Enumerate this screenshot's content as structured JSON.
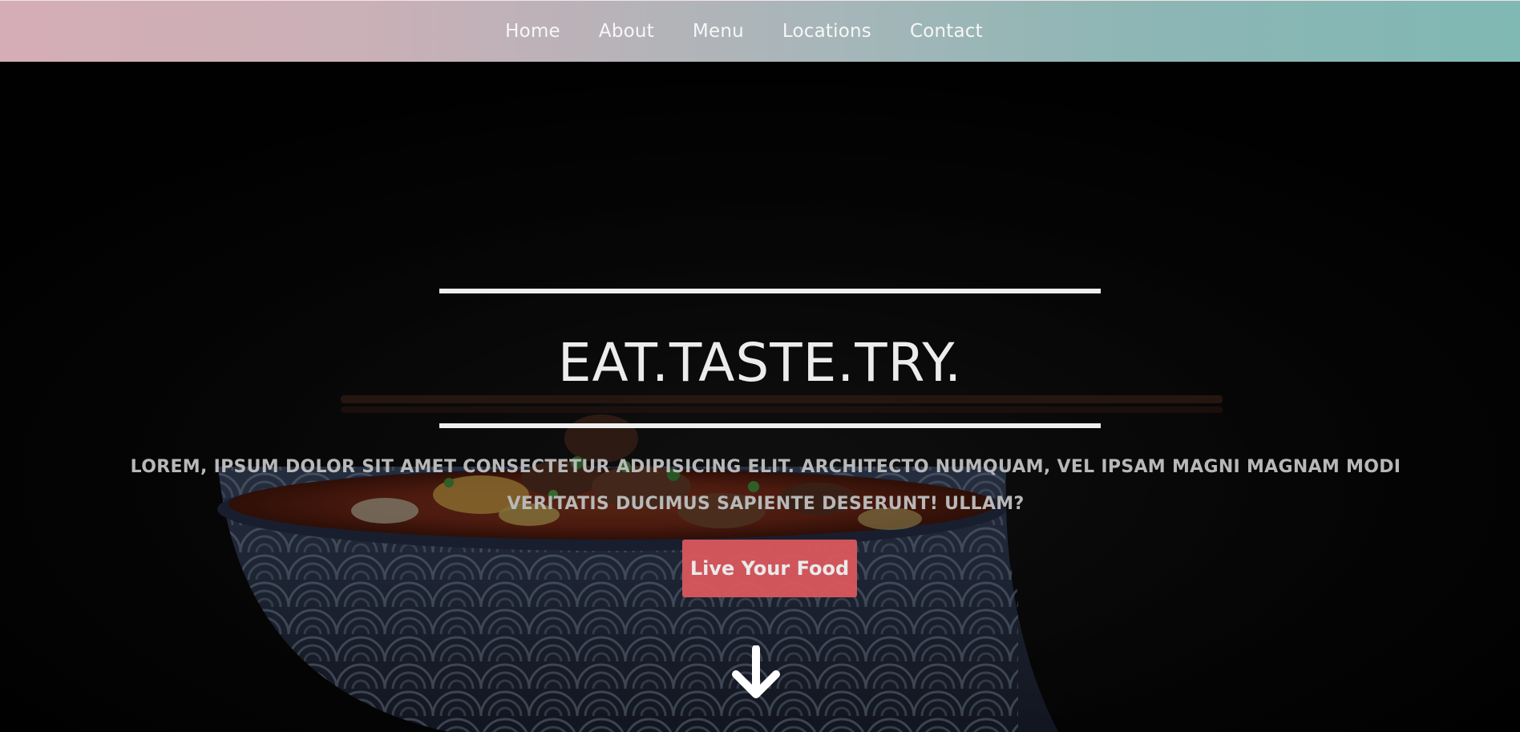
{
  "nav": {
    "items": [
      {
        "label": "Home"
      },
      {
        "label": "About"
      },
      {
        "label": "Menu"
      },
      {
        "label": "Locations"
      },
      {
        "label": "Contact"
      }
    ]
  },
  "hero": {
    "title": "EAT.TASTE.TRY.",
    "description": "LOREM, IPSUM DOLOR SIT AMET CONSECTETUR ADIPISICING ELIT. ARCHITECTO NUMQUAM, VEL IPSAM MAGNI MAGNAM MODI VERITATIS DUCIMUS SAPIENTE DESERUNT! ULLAM?",
    "cta_label": "Live Your Food",
    "scroll_icon": "arrow-down-icon",
    "background_image": "noodle-soup-bowl"
  },
  "colors": {
    "nav_gradient_start": "#d5adb6",
    "nav_gradient_end": "#80b8b4",
    "cta_background": "#d9585d",
    "rule_color": "#efefef"
  }
}
